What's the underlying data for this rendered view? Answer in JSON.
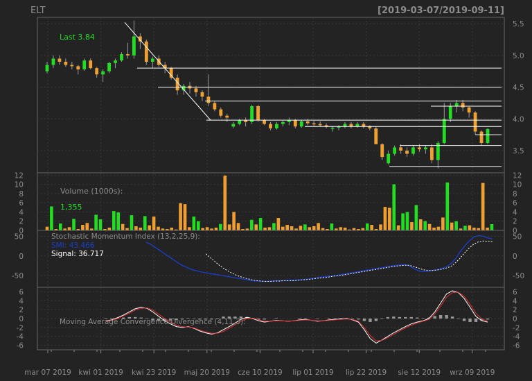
{
  "window": {
    "symbol": "ELT",
    "date_range": "[2019-03-07/2019-09-11]"
  },
  "colors": {
    "background": "#232323",
    "panel_border": "#666666",
    "grid": "#3a3a3a",
    "axis_text": "#8c8c8c",
    "up_candle": "#22dd22",
    "down_candle": "#f0a030",
    "line_white": "#ffffff",
    "smi_blue": "#1a3fcf",
    "macd_red": "#e03030",
    "histogram": "#999999",
    "legend_green": "#22dd22",
    "label_gray": "#8c8c8c"
  },
  "chart_data": [
    {
      "type": "candlestick",
      "panel": "price",
      "annotation": "Last 3.84",
      "x_ticks": [
        "mar 07 2019",
        "kwi 01 2019",
        "kwi 23 2019",
        "maj 20 2019",
        "cze 10 2019",
        "lip 01 2019",
        "lip 22 2019",
        "sie 12 2019",
        "wrz 09 2019"
      ],
      "y_ticks": [
        3.5,
        4.0,
        4.5,
        5.0,
        5.5
      ],
      "ylim": [
        3.15,
        5.6
      ],
      "ohlc": [
        [
          4.75,
          4.9,
          4.72,
          4.85
        ],
        [
          4.85,
          5.0,
          4.8,
          4.95
        ],
        [
          4.95,
          5.0,
          4.85,
          4.9
        ],
        [
          4.9,
          4.95,
          4.82,
          4.85
        ],
        [
          4.85,
          4.9,
          4.78,
          4.83
        ],
        [
          4.83,
          4.85,
          4.7,
          4.78
        ],
        [
          4.78,
          4.95,
          4.76,
          4.92
        ],
        [
          4.92,
          4.95,
          4.78,
          4.8
        ],
        [
          4.8,
          4.82,
          4.65,
          4.7
        ],
        [
          4.7,
          4.78,
          4.58,
          4.75
        ],
        [
          4.75,
          4.9,
          4.72,
          4.88
        ],
        [
          4.88,
          4.95,
          4.8,
          4.92
        ],
        [
          4.92,
          5.05,
          4.9,
          5.02
        ],
        [
          5.02,
          5.2,
          4.95,
          5.0
        ],
        [
          5.0,
          5.55,
          4.95,
          5.3
        ],
        [
          5.3,
          5.35,
          5.1,
          5.22
        ],
        [
          5.22,
          5.25,
          4.85,
          4.9
        ],
        [
          4.9,
          4.98,
          4.8,
          4.95
        ],
        [
          4.95,
          5.0,
          4.82,
          4.85
        ],
        [
          4.85,
          4.9,
          4.72,
          4.8
        ],
        [
          4.8,
          4.82,
          4.62,
          4.65
        ],
        [
          4.65,
          4.7,
          4.38,
          4.45
        ],
        [
          4.45,
          4.55,
          4.38,
          4.52
        ],
        [
          4.52,
          4.58,
          4.4,
          4.48
        ],
        [
          4.48,
          4.52,
          4.35,
          4.42
        ],
        [
          4.42,
          4.45,
          4.28,
          4.35
        ],
        [
          4.35,
          4.7,
          4.2,
          4.25
        ],
        [
          4.25,
          4.28,
          4.12,
          4.15
        ],
        [
          4.15,
          4.18,
          4.02,
          4.05
        ],
        [
          4.05,
          4.08,
          3.95,
          4.02
        ],
        [
          3.88,
          3.95,
          3.85,
          3.92
        ],
        [
          3.92,
          4.0,
          3.9,
          3.98
        ],
        [
          3.98,
          4.02,
          3.88,
          3.95
        ],
        [
          3.95,
          4.22,
          3.92,
          4.2
        ],
        [
          4.2,
          4.22,
          3.95,
          3.98
        ],
        [
          3.98,
          4.0,
          3.9,
          3.92
        ],
        [
          3.92,
          3.95,
          3.82,
          3.85
        ],
        [
          3.85,
          3.95,
          3.83,
          3.92
        ],
        [
          3.92,
          3.98,
          3.88,
          3.95
        ],
        [
          3.95,
          4.02,
          3.9,
          3.98
        ],
        [
          3.98,
          4.0,
          3.85,
          3.88
        ],
        [
          3.88,
          3.98,
          3.86,
          3.96
        ],
        [
          3.96,
          4.0,
          3.9,
          3.93
        ],
        [
          3.93,
          3.97,
          3.88,
          3.92
        ],
        [
          3.92,
          3.96,
          3.88,
          3.9
        ],
        [
          3.9,
          3.93,
          3.85,
          3.88
        ],
        [
          3.85,
          3.88,
          3.8,
          3.86
        ],
        [
          3.86,
          3.9,
          3.82,
          3.88
        ],
        [
          3.88,
          3.95,
          3.85,
          3.92
        ],
        [
          3.92,
          3.95,
          3.85,
          3.88
        ],
        [
          3.88,
          3.95,
          3.86,
          3.92
        ],
        [
          3.92,
          3.95,
          3.85,
          3.88
        ],
        [
          3.88,
          3.9,
          3.82,
          3.85
        ],
        [
          3.85,
          3.88,
          3.78,
          3.6
        ],
        [
          3.6,
          3.62,
          3.35,
          3.4
        ],
        [
          3.3,
          3.5,
          3.28,
          3.45
        ],
        [
          3.45,
          3.58,
          3.42,
          3.55
        ],
        [
          3.55,
          3.6,
          3.45,
          3.5
        ],
        [
          3.5,
          3.55,
          3.4,
          3.45
        ],
        [
          3.45,
          3.58,
          3.42,
          3.55
        ],
        [
          3.55,
          3.6,
          3.48,
          3.52
        ],
        [
          3.52,
          3.58,
          3.45,
          3.55
        ],
        [
          3.55,
          3.6,
          3.3,
          3.35
        ],
        [
          3.35,
          3.65,
          3.22,
          3.62
        ],
        [
          3.62,
          4.25,
          3.6,
          4.0
        ],
        [
          4.0,
          4.25,
          3.95,
          4.2
        ],
        [
          4.2,
          4.3,
          4.1,
          4.25
        ],
        [
          4.25,
          4.3,
          4.12,
          4.18
        ],
        [
          4.18,
          4.2,
          4.02,
          4.1
        ],
        [
          4.1,
          4.12,
          3.75,
          3.8
        ],
        [
          3.8,
          3.82,
          3.58,
          3.62
        ],
        [
          3.62,
          3.85,
          3.6,
          3.84
        ]
      ],
      "horizontal_levels": [
        4.8,
        4.5,
        4.28,
        4.2,
        3.98,
        3.88,
        3.75,
        3.58,
        3.25
      ],
      "trendline": [
        [
          5.52,
          3.98
        ]
      ]
    },
    {
      "type": "bar",
      "panel": "volume",
      "title": "Volume (1000s):",
      "last_value": "1,355",
      "y_ticks": [
        0,
        2,
        4,
        6,
        8,
        10,
        12
      ],
      "ylim": [
        0,
        12.5
      ],
      "values": [
        0.8,
        5.2,
        0.3,
        1.5,
        0.4,
        0.7,
        2.5,
        0.3,
        1.2,
        1.6,
        0.4,
        3.4,
        2.4,
        0.3,
        0.6,
        4.2,
        3.9,
        1.4,
        0.5,
        3.3,
        0.9,
        0.6,
        3.1,
        1.1,
        3.0,
        0.8,
        0.4,
        0.3,
        0.6,
        0.2,
        5.9,
        5.7,
        0.7,
        3.0,
        2.0,
        0.5,
        0.7,
        0.4,
        0.6,
        1.4,
        11.9,
        1.3,
        4.0,
        1.6,
        0.3,
        0.4,
        2.3,
        1.3,
        2.7,
        0.6,
        0.7,
        1.6,
        2.7,
        0.8,
        1.2,
        0.9,
        0.4,
        1.0,
        1.3,
        0.7,
        0.9,
        1.6,
        0.5,
        0.3,
        1.5,
        0.4,
        0.7,
        0.6,
        0.2,
        0.5,
        0.3,
        0.5,
        1.5,
        1.2,
        0.3,
        1.3,
        5.1,
        4.9,
        10.0,
        1.1,
        3.7,
        4.0,
        1.8,
        5.5,
        2.4,
        2.0,
        1.4,
        0.6,
        0.8,
        2.8,
        10.4,
        1.7,
        2.0,
        0.4,
        1.0,
        1.1,
        0.6,
        0.5,
        10.3,
        0.6,
        1.355
      ],
      "up": [
        false,
        true,
        false,
        true,
        false,
        false,
        true,
        false,
        false,
        false,
        false,
        true,
        true,
        false,
        false,
        true,
        true,
        false,
        false,
        true,
        false,
        false,
        true,
        false,
        false,
        false,
        false,
        false,
        false,
        false,
        false,
        false,
        false,
        true,
        true,
        false,
        false,
        false,
        false,
        true,
        false,
        false,
        false,
        false,
        false,
        false,
        true,
        false,
        true,
        false,
        false,
        true,
        false,
        false,
        false,
        false,
        false,
        false,
        true,
        false,
        false,
        false,
        false,
        false,
        true,
        false,
        false,
        false,
        false,
        false,
        false,
        false,
        true,
        false,
        false,
        false,
        false,
        false,
        true,
        false,
        true,
        true,
        false,
        true,
        false,
        true,
        false,
        false,
        false,
        false,
        true,
        false,
        true,
        false,
        true,
        false,
        false,
        false,
        false,
        false,
        true
      ]
    },
    {
      "type": "line",
      "panel": "stochastic_momentum",
      "title": "Stochastic Momentum Index (13,2,25,9):",
      "y_ticks": [
        -50,
        0,
        50
      ],
      "ylim": [
        -80,
        65
      ],
      "series": [
        {
          "name": "SMI",
          "label": "SMI: 43.466",
          "values": [
            -99,
            -99,
            -99,
            -99,
            -99,
            -99,
            -99,
            -99,
            -99,
            -99,
            -99,
            -99,
            -99,
            -99,
            -99,
            -99,
            -99,
            -99,
            -99,
            -99,
            -99,
            -99,
            -99,
            -99,
            -99,
            35,
            30,
            22,
            14,
            6,
            -2,
            -10,
            -18,
            -25,
            -30,
            -35,
            -38,
            -41,
            -43,
            -45,
            -47,
            -49,
            -51,
            -53,
            -55,
            -57,
            -59,
            -61,
            -63,
            -64,
            -65,
            -65,
            -64,
            -63,
            -63,
            -63,
            -62,
            -62,
            -61,
            -60,
            -59,
            -57,
            -56,
            -54,
            -53,
            -51,
            -50,
            -48,
            -46,
            -44,
            -42,
            -40,
            -38,
            -36,
            -34,
            -32,
            -30,
            -28,
            -26,
            -24,
            -23,
            -22,
            -25,
            -32,
            -38,
            -40,
            -39,
            -37,
            -35,
            -32,
            -28,
            -20,
            -8,
            10,
            25,
            38,
            48,
            52,
            50,
            46,
            43.466
          ]
        },
        {
          "name": "Signal",
          "label": "Signal: 36.717",
          "values": [
            -99,
            -99,
            -99,
            -99,
            -99,
            -99,
            -99,
            -99,
            -99,
            -99,
            -99,
            -99,
            -99,
            -99,
            -99,
            -99,
            -99,
            -99,
            -99,
            -99,
            -99,
            -99,
            -99,
            -99,
            -99,
            -99,
            -99,
            -99,
            -99,
            -99,
            -99,
            -99,
            -99,
            -99,
            -99,
            -99,
            -99,
            -99,
            5,
            -5,
            -15,
            -25,
            -33,
            -40,
            -46,
            -51,
            -55,
            -58,
            -61,
            -63,
            -64,
            -65,
            -65,
            -64,
            -64,
            -63,
            -63,
            -63,
            -62,
            -61,
            -60,
            -59,
            -57,
            -56,
            -55,
            -53,
            -51,
            -50,
            -48,
            -46,
            -44,
            -42,
            -40,
            -38,
            -36,
            -34,
            -32,
            -30,
            -28,
            -26,
            -25,
            -24,
            -24,
            -27,
            -31,
            -35,
            -37,
            -37,
            -36,
            -34,
            -31,
            -27,
            -18,
            -6,
            8,
            20,
            30,
            36,
            38,
            37,
            36.717
          ]
        }
      ]
    },
    {
      "type": "line",
      "panel": "macd",
      "title": "Moving Average Convergence Divergence (4,11,3):",
      "y_ticks": [
        -6,
        -4,
        -2,
        0,
        2,
        4,
        6
      ],
      "ylim": [
        -7,
        7
      ],
      "series": [
        {
          "name": "MACD",
          "values": [
            -99,
            -99,
            -99,
            -99,
            -99,
            -99,
            -99,
            -99,
            -99,
            -99,
            -0.5,
            -0.3,
            0.2,
            0.8,
            1.5,
            2.2,
            2.5,
            2.3,
            1.5,
            0.5,
            -0.5,
            -1.2,
            -1.8,
            -2.0,
            -1.8,
            -2.2,
            -2.8,
            -3.2,
            -3.5,
            -3.2,
            -2.5,
            -1.8,
            -1.0,
            -0.2,
            0.3,
            0.0,
            -0.5,
            -0.8,
            -0.6,
            -0.4,
            -0.5,
            -0.6,
            -0.5,
            -0.3,
            -0.2,
            -0.4,
            -0.6,
            -0.5,
            -0.3,
            -0.2,
            -0.1,
            0.0,
            -0.3,
            -0.8,
            -2.5,
            -4.5,
            -5.5,
            -4.8,
            -4.0,
            -3.2,
            -2.5,
            -1.8,
            -1.2,
            -0.8,
            -0.5,
            0.0,
            1.5,
            3.5,
            5.5,
            6.2,
            5.8,
            4.5,
            2.5,
            0.5,
            -0.5,
            -0.8
          ]
        },
        {
          "name": "Signal",
          "values": [
            -99,
            -99,
            -99,
            -99,
            -99,
            -99,
            -99,
            -99,
            -99,
            -99,
            -0.6,
            -0.4,
            0.0,
            0.6,
            1.2,
            1.9,
            2.3,
            2.4,
            1.9,
            1.0,
            0.0,
            -0.8,
            -1.5,
            -1.8,
            -1.9,
            -2.1,
            -2.6,
            -3.0,
            -3.3,
            -3.3,
            -2.9,
            -2.2,
            -1.4,
            -0.6,
            0.0,
            0.1,
            -0.3,
            -0.6,
            -0.6,
            -0.5,
            -0.5,
            -0.6,
            -0.5,
            -0.4,
            -0.3,
            -0.4,
            -0.5,
            -0.5,
            -0.4,
            -0.3,
            -0.2,
            -0.1,
            -0.2,
            -0.6,
            -2.0,
            -3.8,
            -5.0,
            -4.9,
            -4.3,
            -3.6,
            -2.8,
            -2.1,
            -1.5,
            -1.0,
            -0.6,
            -0.2,
            1.0,
            2.8,
            4.8,
            5.8,
            5.9,
            5.0,
            3.2,
            1.2,
            -0.1,
            -0.6
          ]
        },
        {
          "name": "Histogram",
          "values": [
            0,
            0,
            0,
            0,
            0,
            0,
            0,
            0,
            0,
            0,
            0.1,
            0.1,
            0.2,
            0.2,
            0.3,
            0.3,
            0.2,
            -0.1,
            -0.4,
            -0.5,
            -0.5,
            -0.4,
            -0.3,
            -0.2,
            0.1,
            -0.1,
            -0.2,
            -0.2,
            -0.2,
            0.1,
            0.4,
            0.4,
            0.4,
            0.4,
            0.3,
            -0.1,
            -0.2,
            -0.2,
            0.0,
            0.1,
            0.0,
            0.0,
            0.0,
            0.1,
            0.1,
            0.0,
            -0.1,
            0.0,
            0.1,
            0.1,
            0.1,
            0.1,
            -0.1,
            -0.2,
            -0.5,
            -0.7,
            -0.5,
            0.1,
            0.3,
            0.4,
            0.3,
            0.3,
            0.3,
            0.2,
            0.1,
            0.2,
            0.5,
            0.7,
            0.7,
            0.4,
            -0.1,
            -0.5,
            -0.7,
            -0.7,
            -0.4,
            -0.2
          ]
        }
      ]
    }
  ]
}
